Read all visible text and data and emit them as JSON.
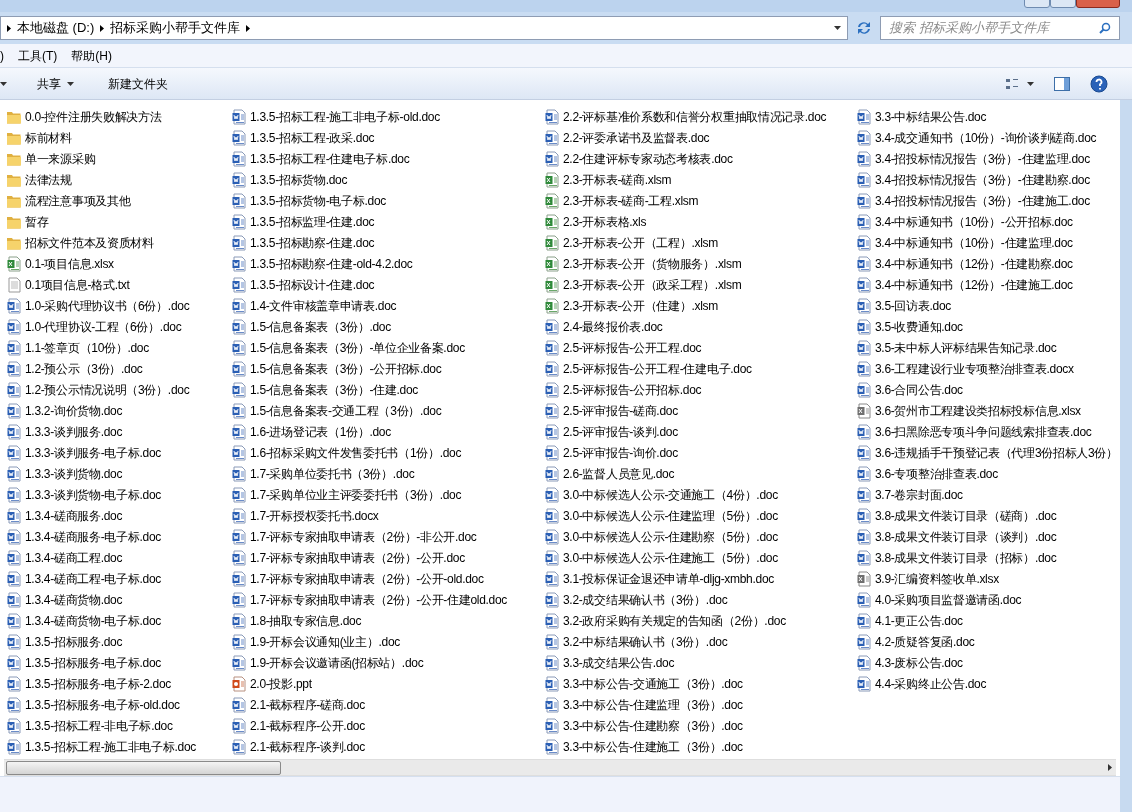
{
  "address": {
    "segments": [
      "本地磁盘 (D:)",
      "招标采购小帮手文件库"
    ]
  },
  "search": {
    "placeholder": "搜索 招标采购小帮手文件库"
  },
  "menu": [
    ")",
    "工具(T)",
    "帮助(H)"
  ],
  "toolbar": [
    {
      "label": "共享",
      "dropdown": true
    },
    {
      "label": "新建文件夹",
      "dropdown": false
    }
  ],
  "columns": [
    [
      {
        "name": "0.0-控件注册失败解决方法",
        "kind": "folder"
      },
      {
        "name": "标前材料",
        "kind": "folder"
      },
      {
        "name": "单一来源采购",
        "kind": "folder"
      },
      {
        "name": "法律法规",
        "kind": "folder"
      },
      {
        "name": "流程注意事项及其他",
        "kind": "folder"
      },
      {
        "name": "暂存",
        "kind": "folder"
      },
      {
        "name": "招标文件范本及资质材料",
        "kind": "folder"
      },
      {
        "name": "0.1-项目信息.xlsx",
        "kind": "excel"
      },
      {
        "name": "0.1项目信息-格式.txt",
        "kind": "text"
      },
      {
        "name": "1.0-采购代理协议书（6份）.doc",
        "kind": "word"
      },
      {
        "name": "1.0-代理协议-工程（6份）.doc",
        "kind": "word"
      },
      {
        "name": "1.1-签章页（10份）.doc",
        "kind": "word"
      },
      {
        "name": "1.2-预公示（3份）.doc",
        "kind": "word"
      },
      {
        "name": "1.2-预公示情况说明（3份）.doc",
        "kind": "word"
      },
      {
        "name": "1.3.2-询价货物.doc",
        "kind": "word"
      },
      {
        "name": "1.3.3-谈判服务.doc",
        "kind": "word"
      },
      {
        "name": "1.3.3-谈判服务-电子标.doc",
        "kind": "word"
      },
      {
        "name": "1.3.3-谈判货物.doc",
        "kind": "word"
      },
      {
        "name": "1.3.3-谈判货物-电子标.doc",
        "kind": "word"
      },
      {
        "name": "1.3.4-磋商服务.doc",
        "kind": "word"
      },
      {
        "name": "1.3.4-磋商服务-电子标.doc",
        "kind": "word"
      },
      {
        "name": "1.3.4-磋商工程.doc",
        "kind": "word"
      },
      {
        "name": "1.3.4-磋商工程-电子标.doc",
        "kind": "word"
      },
      {
        "name": "1.3.4-磋商货物.doc",
        "kind": "word"
      },
      {
        "name": "1.3.4-磋商货物-电子标.doc",
        "kind": "word"
      },
      {
        "name": "1.3.5-招标服务.doc",
        "kind": "word"
      },
      {
        "name": "1.3.5-招标服务-电子标.doc",
        "kind": "word"
      },
      {
        "name": "1.3.5-招标服务-电子标-2.doc",
        "kind": "word"
      },
      {
        "name": "1.3.5-招标服务-电子标-old.doc",
        "kind": "word"
      },
      {
        "name": "1.3.5-招标工程-非电子标.doc",
        "kind": "word"
      },
      {
        "name": "1.3.5-招标工程-施工非电子标.doc",
        "kind": "word"
      }
    ],
    [
      {
        "name": "1.3.5-招标工程-施工非电子标-old.doc",
        "kind": "word"
      },
      {
        "name": "1.3.5-招标工程-政采.doc",
        "kind": "word"
      },
      {
        "name": "1.3.5-招标工程-住建电子标.doc",
        "kind": "word"
      },
      {
        "name": "1.3.5-招标货物.doc",
        "kind": "word"
      },
      {
        "name": "1.3.5-招标货物-电子标.doc",
        "kind": "word"
      },
      {
        "name": "1.3.5-招标监理-住建.doc",
        "kind": "word"
      },
      {
        "name": "1.3.5-招标勘察-住建.doc",
        "kind": "word"
      },
      {
        "name": "1.3.5-招标勘察-住建-old-4.2.doc",
        "kind": "word"
      },
      {
        "name": "1.3.5-招标设计-住建.doc",
        "kind": "word"
      },
      {
        "name": "1.4-文件审核盖章申请表.doc",
        "kind": "word"
      },
      {
        "name": "1.5-信息备案表（3份）.doc",
        "kind": "word"
      },
      {
        "name": "1.5-信息备案表（3份）-单位企业备案.doc",
        "kind": "word"
      },
      {
        "name": "1.5-信息备案表（3份）-公开招标.doc",
        "kind": "word"
      },
      {
        "name": "1.5-信息备案表（3份）-住建.doc",
        "kind": "word"
      },
      {
        "name": "1.5-信息备案表-交通工程（3份）.doc",
        "kind": "word"
      },
      {
        "name": "1.6-进场登记表（1份）.doc",
        "kind": "word"
      },
      {
        "name": "1.6-招标采购文件发售委托书（1份）.doc",
        "kind": "word"
      },
      {
        "name": "1.7-采购单位委托书（3份）.doc",
        "kind": "word"
      },
      {
        "name": "1.7-采购单位业主评委委托书（3份）.doc",
        "kind": "word"
      },
      {
        "name": "1.7-开标授权委托书.docx",
        "kind": "word"
      },
      {
        "name": "1.7-评标专家抽取申请表（2份）-非公开.doc",
        "kind": "word"
      },
      {
        "name": "1.7-评标专家抽取申请表（2份）-公开.doc",
        "kind": "word"
      },
      {
        "name": "1.7-评标专家抽取申请表（2份）-公开-old.doc",
        "kind": "word"
      },
      {
        "name": "1.7-评标专家抽取申请表（2份）-公开-住建old.doc",
        "kind": "word"
      },
      {
        "name": "1.8-抽取专家信息.doc",
        "kind": "word"
      },
      {
        "name": "1.9-开标会议通知(业主）.doc",
        "kind": "word"
      },
      {
        "name": "1.9-开标会议邀请函(招标站）.doc",
        "kind": "word"
      },
      {
        "name": "2.0-投影.ppt",
        "kind": "slides"
      },
      {
        "name": "2.1-截标程序-磋商.doc",
        "kind": "word"
      },
      {
        "name": "2.1-截标程序-公开.doc",
        "kind": "word"
      },
      {
        "name": "2.1-截标程序-谈判.doc",
        "kind": "word"
      }
    ],
    [
      {
        "name": "2.2-评标基准价系数和信誉分权重抽取情况记录.doc",
        "kind": "word"
      },
      {
        "name": "2.2-评委承诺书及监督表.doc",
        "kind": "word"
      },
      {
        "name": "2.2-住建评标专家动态考核表.doc",
        "kind": "word"
      },
      {
        "name": "2.3-开标表-磋商.xlsm",
        "kind": "excel"
      },
      {
        "name": "2.3-开标表-磋商-工程.xlsm",
        "kind": "excel"
      },
      {
        "name": "2.3-开标表格.xls",
        "kind": "excel"
      },
      {
        "name": "2.3-开标表-公开（工程）.xlsm",
        "kind": "excel"
      },
      {
        "name": "2.3-开标表-公开（货物服务）.xlsm",
        "kind": "excel"
      },
      {
        "name": "2.3-开标表-公开（政采工程）.xlsm",
        "kind": "excel"
      },
      {
        "name": "2.3-开标表-公开（住建）.xlsm",
        "kind": "excel"
      },
      {
        "name": "2.4-最终报价表.doc",
        "kind": "word"
      },
      {
        "name": "2.5-评标报告-公开工程.doc",
        "kind": "word"
      },
      {
        "name": "2.5-评标报告-公开工程-住建电子.doc",
        "kind": "word"
      },
      {
        "name": "2.5-评标报告-公开招标.doc",
        "kind": "word"
      },
      {
        "name": "2.5-评审报告-磋商.doc",
        "kind": "word"
      },
      {
        "name": "2.5-评审报告-谈判.doc",
        "kind": "word"
      },
      {
        "name": "2.5-评审报告-询价.doc",
        "kind": "word"
      },
      {
        "name": "2.6-监督人员意见.doc",
        "kind": "word"
      },
      {
        "name": "3.0-中标候选人公示-交通施工（4份）.doc",
        "kind": "word"
      },
      {
        "name": "3.0-中标候选人公示-住建监理（5份）.doc",
        "kind": "word"
      },
      {
        "name": "3.0-中标候选人公示-住建勘察（5份）.doc",
        "kind": "word"
      },
      {
        "name": "3.0-中标候选人公示-住建施工（5份）.doc",
        "kind": "word"
      },
      {
        "name": "3.1-投标保证金退还申请单-dljg-xmbh.doc",
        "kind": "word"
      },
      {
        "name": "3.2-成交结果确认书（3份）.doc",
        "kind": "word"
      },
      {
        "name": "3.2-政府采购有关规定的告知函（2份）.doc",
        "kind": "word"
      },
      {
        "name": "3.2-中标结果确认书（3份）.doc",
        "kind": "word"
      },
      {
        "name": "3.3-成交结果公告.doc",
        "kind": "word"
      },
      {
        "name": "3.3-中标公告-交通施工（3份）.doc",
        "kind": "word"
      },
      {
        "name": "3.3-中标公告-住建监理（3份）.doc",
        "kind": "word"
      },
      {
        "name": "3.3-中标公告-住建勘察（3份）.doc",
        "kind": "word"
      },
      {
        "name": "3.3-中标公告-住建施工（3份）.doc",
        "kind": "word"
      }
    ],
    [
      {
        "name": "3.3-中标结果公告.doc",
        "kind": "word"
      },
      {
        "name": "3.4-成交通知书（10份）-询价谈判磋商.doc",
        "kind": "word"
      },
      {
        "name": "3.4-招投标情况报告（3份）-住建监理.doc",
        "kind": "word"
      },
      {
        "name": "3.4-招投标情况报告（3份）-住建勘察.doc",
        "kind": "word"
      },
      {
        "name": "3.4-招投标情况报告（3份）-住建施工.doc",
        "kind": "word"
      },
      {
        "name": "3.4-中标通知书（10份）-公开招标.doc",
        "kind": "word"
      },
      {
        "name": "3.4-中标通知书（10份）-住建监理.doc",
        "kind": "word"
      },
      {
        "name": "3.4-中标通知书（12份）-住建勘察.doc",
        "kind": "word"
      },
      {
        "name": "3.4-中标通知书（12份）-住建施工.doc",
        "kind": "word"
      },
      {
        "name": "3.5-回访表.doc",
        "kind": "word"
      },
      {
        "name": "3.5-收费通知.doc",
        "kind": "word"
      },
      {
        "name": "3.5-未中标人评标结果告知记录.doc",
        "kind": "word"
      },
      {
        "name": "3.6-工程建设行业专项整治排查表.docx",
        "kind": "word"
      },
      {
        "name": "3.6-合同公告.doc",
        "kind": "word"
      },
      {
        "name": "3.6-贺州市工程建设类招标投标信息.xlsx",
        "kind": "sheet-generic"
      },
      {
        "name": "3.6-扫黑除恶专项斗争问题线索排查表.doc",
        "kind": "word"
      },
      {
        "name": "3.6-违规插手干预登记表（代理3份招标人3份）",
        "kind": "word"
      },
      {
        "name": "3.6-专项整治排查表.doc",
        "kind": "word"
      },
      {
        "name": "3.7-卷宗封面.doc",
        "kind": "word"
      },
      {
        "name": "3.8-成果文件装订目录（磋商）.doc",
        "kind": "word"
      },
      {
        "name": "3.8-成果文件装订目录（谈判）.doc",
        "kind": "word"
      },
      {
        "name": "3.8-成果文件装订目录（招标）.doc",
        "kind": "word"
      },
      {
        "name": "3.9-汇编资料签收单.xlsx",
        "kind": "sheet-generic"
      },
      {
        "name": "4.0-采购项目监督邀请函.doc",
        "kind": "word"
      },
      {
        "name": "4.1-更正公告.doc",
        "kind": "word"
      },
      {
        "name": "4.2-质疑答复函.doc",
        "kind": "word"
      },
      {
        "name": "4.3-废标公告.doc",
        "kind": "word"
      },
      {
        "name": "4.4-采购终止公告.doc",
        "kind": "word"
      }
    ]
  ]
}
